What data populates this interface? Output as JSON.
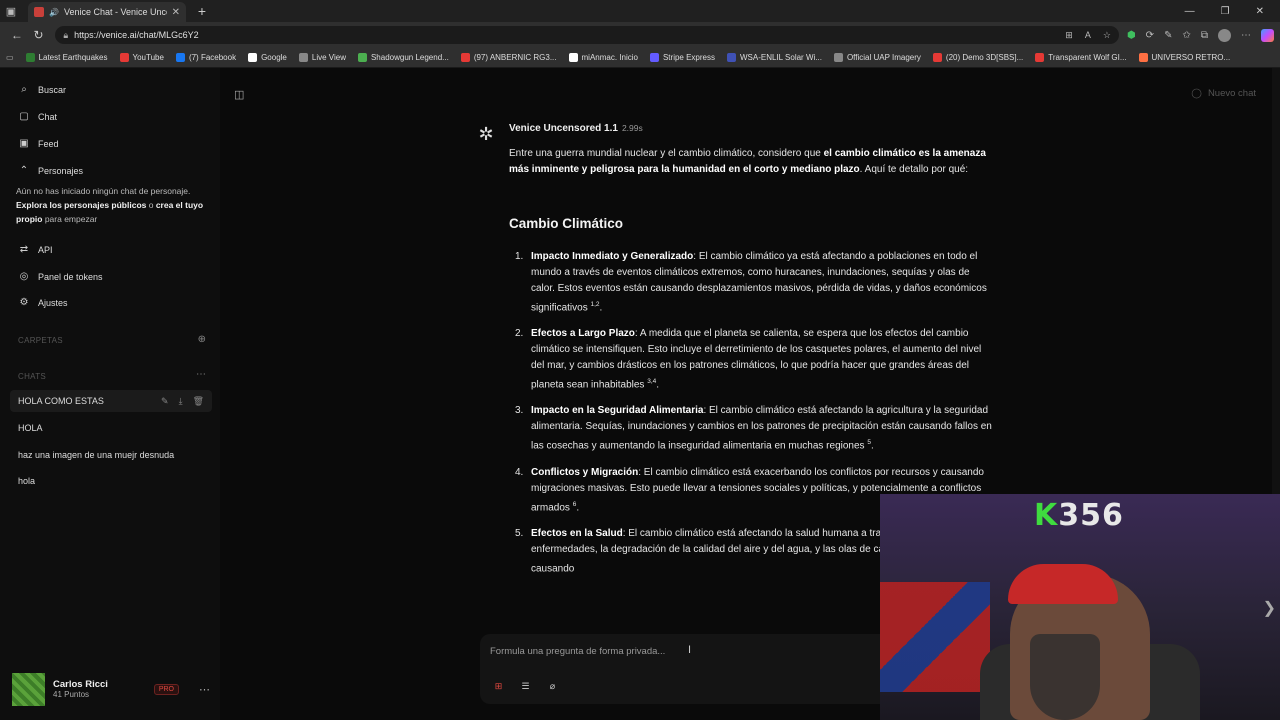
{
  "browser": {
    "tab_title": "Venice Chat - Venice Uncen",
    "url": "https://venice.ai/chat/MLGc6Y2",
    "bookmarks": [
      {
        "label": "Latest Earthquakes",
        "color": "#2e7d32"
      },
      {
        "label": "YouTube",
        "color": "#e53935"
      },
      {
        "label": "(7) Facebook",
        "color": "#1877f2"
      },
      {
        "label": "Google",
        "color": "#ffffff"
      },
      {
        "label": "Live View",
        "color": "#888888"
      },
      {
        "label": "Shadowgun Legend...",
        "color": "#4caf50"
      },
      {
        "label": "(97) ANBERNIC RG3...",
        "color": "#e53935"
      },
      {
        "label": "miAnmac. Inicio",
        "color": "#ffffff"
      },
      {
        "label": "Stripe Express",
        "color": "#635bff"
      },
      {
        "label": "WSA-ENLIL Solar Wi...",
        "color": "#3f51b5"
      },
      {
        "label": "Official UAP Imagery",
        "color": "#888888"
      },
      {
        "label": "(20) Demo 3D[SBS]...",
        "color": "#e53935"
      },
      {
        "label": "Transparent Wolf GI...",
        "color": "#e53935"
      },
      {
        "label": "UNIVERSO RETRO...",
        "color": "#ff7043"
      }
    ]
  },
  "sidebar": {
    "search": "Buscar",
    "chat": "Chat",
    "feed": "Feed",
    "personajes": "Personajes",
    "hint_1": "Aún no has iniciado ningún chat de personaje.",
    "hint_link_1": "Explora los personajes públicos",
    "hint_mid": " o ",
    "hint_link_2": "crea el tuyo propio",
    "hint_end": " para empezar",
    "api": "API",
    "tokens": "Panel de tokens",
    "settings": "Ajustes",
    "folders_label": "CARPETAS",
    "chats_label": "CHATS",
    "chats": [
      "HOLA COMO ESTAS",
      "HOLA",
      "haz una imagen de una muejr desnuda",
      "hola"
    ],
    "user_name": "Carlos Ricci",
    "user_points": "41 Puntos",
    "pro_badge": "PRO"
  },
  "header": {
    "new_chat": "Nuevo chat"
  },
  "message": {
    "model": "Venice Uncensored 1.1",
    "time": "2.99s",
    "intro_plain": "Entre una guerra mundial nuclear y el cambio climático, considero que ",
    "intro_bold": "el cambio climático es la amenaza más inminente y peligrosa para la humanidad en el corto y mediano plazo",
    "intro_end": ". Aquí te detallo por qué:",
    "heading": "Cambio Climático",
    "items": [
      {
        "num": "1.",
        "title": "Impacto Inmediato y Generalizado",
        "text": ": El cambio climático ya está afectando a poblaciones en todo el mundo a través de eventos climáticos extremos, como huracanes, inundaciones, sequías y olas de calor. Estos eventos están causando desplazamientos masivos, pérdida de vidas, y daños económicos significativos ",
        "sup": "1,2",
        "end": "."
      },
      {
        "num": "2.",
        "title": "Efectos a Largo Plazo",
        "text": ": A medida que el planeta se calienta, se espera que los efectos del cambio climático se intensifiquen. Esto incluye el derretimiento de los casquetes polares, el aumento del nivel del mar, y cambios drásticos en los patrones climáticos, lo que podría hacer que grandes áreas del planeta sean inhabitables ",
        "sup": "3,4",
        "end": "."
      },
      {
        "num": "3.",
        "title": "Impacto en la Seguridad Alimentaria",
        "text": ": El cambio climático está afectando la agricultura y la seguridad alimentaria. Sequías, inundaciones y cambios en los patrones de precipitación están causando fallos en las cosechas y aumentando la inseguridad alimentaria en muchas regiones ",
        "sup": "5",
        "end": "."
      },
      {
        "num": "4.",
        "title": "Conflictos y Migración",
        "text": ": El cambio climático está exacerbando los conflictos por recursos y causando migraciones masivas. Esto puede llevar a tensiones sociales y políticas, y potencialmente a conflictos armados ",
        "sup": "6",
        "end": "."
      },
      {
        "num": "5.",
        "title": "Efectos en la Salud",
        "text": ": El cambio climático está afectando la salud humana a través de la propagación de enfermedades, la degradación de la calidad del aire y del agua, y las olas de calor, que ya están causando",
        "sup": "",
        "end": ""
      }
    ]
  },
  "composer": {
    "placeholder": "Formula una pregunta de forma privada..."
  },
  "webcam": {
    "badge_letter": "K",
    "badge_number": "356"
  },
  "colors": {
    "accent_red": "#e0483f",
    "badge_green": "#3fdc3f"
  }
}
